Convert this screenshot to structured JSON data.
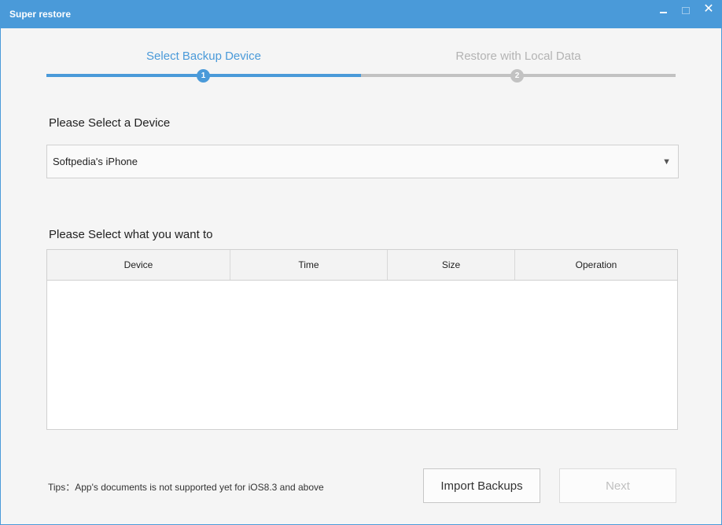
{
  "window": {
    "title": "Super restore",
    "accent_color": "#4a9ad9"
  },
  "stepper": {
    "steps": [
      {
        "number": "1",
        "label": "Select Backup Device",
        "state": "active"
      },
      {
        "number": "2",
        "label": "Restore with Local Data",
        "state": "inactive"
      }
    ]
  },
  "device_section": {
    "label": "Please Select a Device",
    "selected_device": "Softpedia's iPhone",
    "dropdown_icon": "caret-down-icon"
  },
  "backup_section": {
    "label": "Please Select what you want to",
    "table": {
      "columns": [
        "Device",
        "Time",
        "Size",
        "Operation"
      ],
      "rows": []
    }
  },
  "footer": {
    "tips": "Tips：App's documents is not supported yet for iOS8.3 and above",
    "import_button": "Import Backups",
    "next_button": "Next"
  }
}
